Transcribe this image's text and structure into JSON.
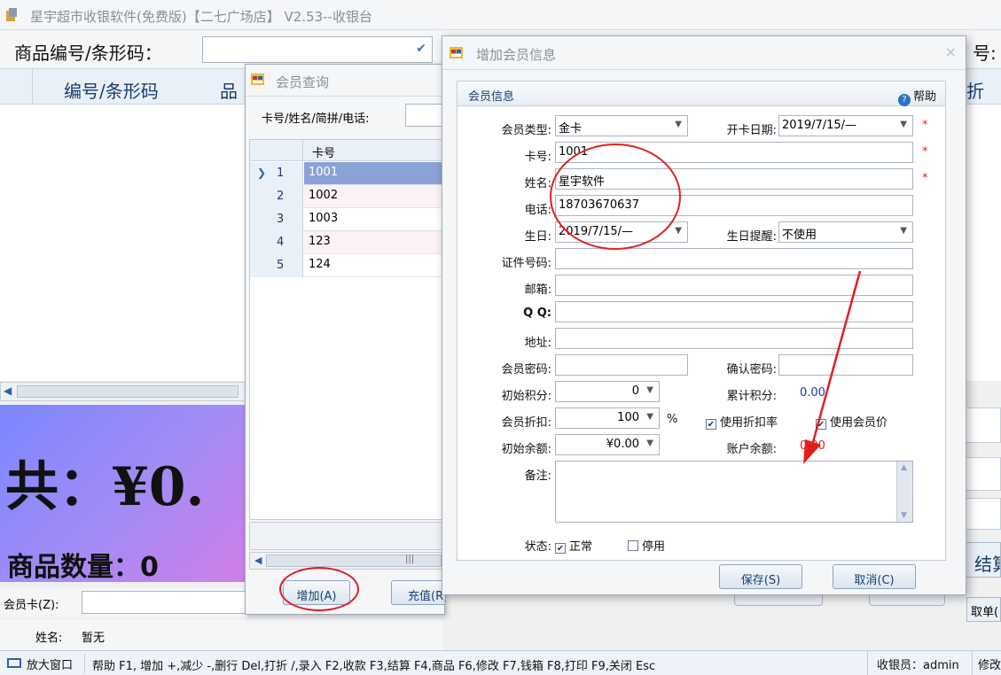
{
  "main": {
    "title": "星宇超市收银软件(免费版)【二七广场店】 V2.53--收银台",
    "barcode_label": "商品编号/条形码：",
    "right_label_fragment": "号:",
    "columns": {
      "code": "编号/条形码",
      "name_fragment": "品",
      "discount_fragment": "折扣"
    },
    "total": "共：¥0.",
    "item_count": "商品数量：0",
    "member_card_label": "会员卡(Z):",
    "name_label": "姓名:",
    "name_value": "暂无",
    "settle_fragment": "结算",
    "take_order_fragment": "取单(",
    "statusbar": {
      "enlarge": "放大窗口",
      "help": "帮助 F1, 增加 +,减少 -,删行 Del,打折 /,录入 F2,收款 F3,结算 F4,商品 F6,修改 F7,钱箱 F8,打印 F9,关闭 Esc",
      "cashier": "收银员：admin",
      "modify_fragment": "修改"
    }
  },
  "query_dialog": {
    "title": "会员查询",
    "search_label": "卡号/姓名/简拼/电话:",
    "column_card": "卡号",
    "rows": [
      {
        "index": "1",
        "card": "1001"
      },
      {
        "index": "2",
        "card": "1002"
      },
      {
        "index": "3",
        "card": "1003"
      },
      {
        "index": "4",
        "card": "123"
      },
      {
        "index": "5",
        "card": "124"
      }
    ],
    "add_button": "增加(A)",
    "recharge_button": "充值(R)"
  },
  "add_dialog": {
    "title": "增加会员信息",
    "group_title": "会员信息",
    "help": "帮助",
    "fields": {
      "member_type_label": "会员类型:",
      "member_type": "金卡",
      "open_date_label": "开卡日期:",
      "open_date": "2019/7/15/—",
      "card_no_label": "卡号:",
      "card_no": "1001",
      "name_label": "姓名:",
      "name": "星宇软件",
      "phone_label": "电话:",
      "phone": "18703670637",
      "birthday_label": "生日:",
      "birthday": "2019/7/15/—",
      "birthday_remind_label": "生日提醒:",
      "birthday_remind": "不使用",
      "id_no_label": "证件号码:",
      "email_label": "邮箱:",
      "qq_label": "Q Q:",
      "address_label": "地址:",
      "password_label": "会员密码:",
      "confirm_password_label": "确认密码:",
      "init_points_label": "初始积分:",
      "init_points": "0",
      "total_points_label": "累计积分:",
      "total_points": "0.00",
      "discount_label": "会员折扣:",
      "discount": "100",
      "percent": "%",
      "use_discount_rate": "使用折扣率",
      "use_member_price": "使用会员价",
      "init_balance_label": "初始余额:",
      "init_balance": "¥0.00",
      "balance_label": "账户余额:",
      "balance": "0.00",
      "remark_label": "备注:",
      "status_label": "状态:",
      "status_normal": "正常",
      "status_disabled": "停用"
    },
    "save_button": "保存(S)",
    "cancel_button": "取消(C)"
  },
  "colors": {
    "accent": "#1a3d6d",
    "selection": "#8aa2d6",
    "annotation_red": "#e02020",
    "required": "#e02020"
  }
}
